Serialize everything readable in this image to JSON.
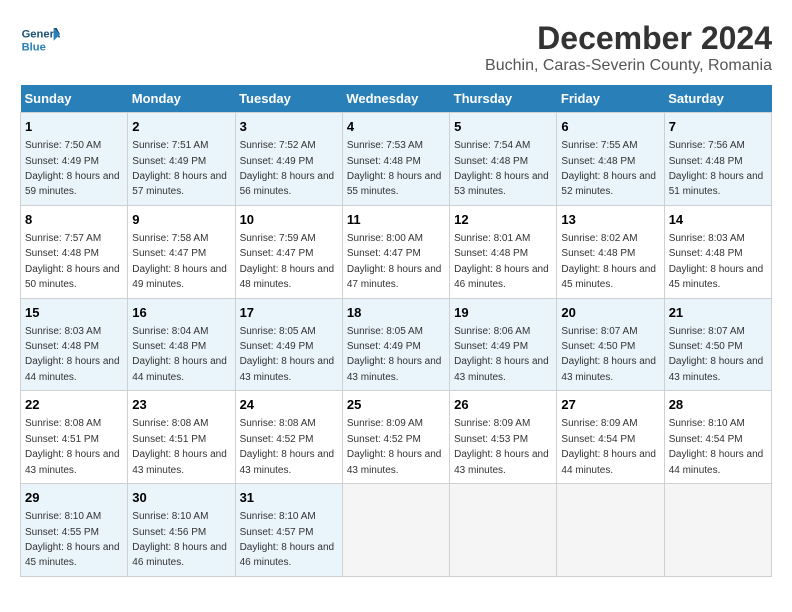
{
  "logo": {
    "line1": "General",
    "line2": "Blue"
  },
  "title": "December 2024",
  "subtitle": "Buchin, Caras-Severin County, Romania",
  "weekdays": [
    "Sunday",
    "Monday",
    "Tuesday",
    "Wednesday",
    "Thursday",
    "Friday",
    "Saturday"
  ],
  "weeks": [
    [
      {
        "day": 1,
        "sunrise": "7:50 AM",
        "sunset": "4:49 PM",
        "daylight": "8 hours and 59 minutes."
      },
      {
        "day": 2,
        "sunrise": "7:51 AM",
        "sunset": "4:49 PM",
        "daylight": "8 hours and 57 minutes."
      },
      {
        "day": 3,
        "sunrise": "7:52 AM",
        "sunset": "4:49 PM",
        "daylight": "8 hours and 56 minutes."
      },
      {
        "day": 4,
        "sunrise": "7:53 AM",
        "sunset": "4:48 PM",
        "daylight": "8 hours and 55 minutes."
      },
      {
        "day": 5,
        "sunrise": "7:54 AM",
        "sunset": "4:48 PM",
        "daylight": "8 hours and 53 minutes."
      },
      {
        "day": 6,
        "sunrise": "7:55 AM",
        "sunset": "4:48 PM",
        "daylight": "8 hours and 52 minutes."
      },
      {
        "day": 7,
        "sunrise": "7:56 AM",
        "sunset": "4:48 PM",
        "daylight": "8 hours and 51 minutes."
      }
    ],
    [
      {
        "day": 8,
        "sunrise": "7:57 AM",
        "sunset": "4:48 PM",
        "daylight": "8 hours and 50 minutes."
      },
      {
        "day": 9,
        "sunrise": "7:58 AM",
        "sunset": "4:47 PM",
        "daylight": "8 hours and 49 minutes."
      },
      {
        "day": 10,
        "sunrise": "7:59 AM",
        "sunset": "4:47 PM",
        "daylight": "8 hours and 48 minutes."
      },
      {
        "day": 11,
        "sunrise": "8:00 AM",
        "sunset": "4:47 PM",
        "daylight": "8 hours and 47 minutes."
      },
      {
        "day": 12,
        "sunrise": "8:01 AM",
        "sunset": "4:48 PM",
        "daylight": "8 hours and 46 minutes."
      },
      {
        "day": 13,
        "sunrise": "8:02 AM",
        "sunset": "4:48 PM",
        "daylight": "8 hours and 45 minutes."
      },
      {
        "day": 14,
        "sunrise": "8:03 AM",
        "sunset": "4:48 PM",
        "daylight": "8 hours and 45 minutes."
      }
    ],
    [
      {
        "day": 15,
        "sunrise": "8:03 AM",
        "sunset": "4:48 PM",
        "daylight": "8 hours and 44 minutes."
      },
      {
        "day": 16,
        "sunrise": "8:04 AM",
        "sunset": "4:48 PM",
        "daylight": "8 hours and 44 minutes."
      },
      {
        "day": 17,
        "sunrise": "8:05 AM",
        "sunset": "4:49 PM",
        "daylight": "8 hours and 43 minutes."
      },
      {
        "day": 18,
        "sunrise": "8:05 AM",
        "sunset": "4:49 PM",
        "daylight": "8 hours and 43 minutes."
      },
      {
        "day": 19,
        "sunrise": "8:06 AM",
        "sunset": "4:49 PM",
        "daylight": "8 hours and 43 minutes."
      },
      {
        "day": 20,
        "sunrise": "8:07 AM",
        "sunset": "4:50 PM",
        "daylight": "8 hours and 43 minutes."
      },
      {
        "day": 21,
        "sunrise": "8:07 AM",
        "sunset": "4:50 PM",
        "daylight": "8 hours and 43 minutes."
      }
    ],
    [
      {
        "day": 22,
        "sunrise": "8:08 AM",
        "sunset": "4:51 PM",
        "daylight": "8 hours and 43 minutes."
      },
      {
        "day": 23,
        "sunrise": "8:08 AM",
        "sunset": "4:51 PM",
        "daylight": "8 hours and 43 minutes."
      },
      {
        "day": 24,
        "sunrise": "8:08 AM",
        "sunset": "4:52 PM",
        "daylight": "8 hours and 43 minutes."
      },
      {
        "day": 25,
        "sunrise": "8:09 AM",
        "sunset": "4:52 PM",
        "daylight": "8 hours and 43 minutes."
      },
      {
        "day": 26,
        "sunrise": "8:09 AM",
        "sunset": "4:53 PM",
        "daylight": "8 hours and 43 minutes."
      },
      {
        "day": 27,
        "sunrise": "8:09 AM",
        "sunset": "4:54 PM",
        "daylight": "8 hours and 44 minutes."
      },
      {
        "day": 28,
        "sunrise": "8:10 AM",
        "sunset": "4:54 PM",
        "daylight": "8 hours and 44 minutes."
      }
    ],
    [
      {
        "day": 29,
        "sunrise": "8:10 AM",
        "sunset": "4:55 PM",
        "daylight": "8 hours and 45 minutes."
      },
      {
        "day": 30,
        "sunrise": "8:10 AM",
        "sunset": "4:56 PM",
        "daylight": "8 hours and 46 minutes."
      },
      {
        "day": 31,
        "sunrise": "8:10 AM",
        "sunset": "4:57 PM",
        "daylight": "8 hours and 46 minutes."
      },
      null,
      null,
      null,
      null
    ]
  ]
}
